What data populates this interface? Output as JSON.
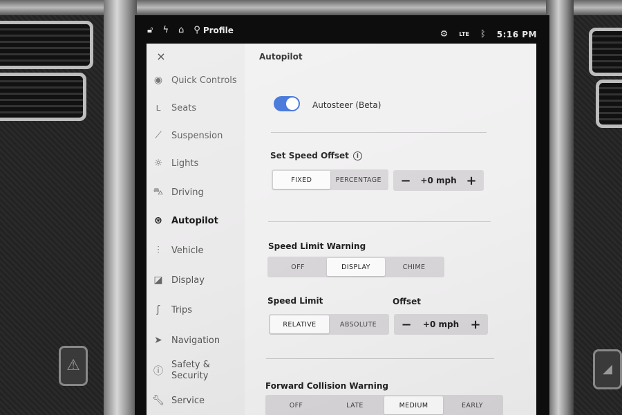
{
  "status_bar": {
    "lock_icon": "unlock-icon",
    "bolt_icon": "lightning-icon",
    "home_icon": "home-icon",
    "profile_icon": "person-icon",
    "profile_label": "Profile",
    "settings_icon": "gear-icon",
    "network": "LTE",
    "bluetooth_icon": "bluetooth-icon",
    "time": "5:16 PM"
  },
  "sidebar": {
    "close_glyph": "×",
    "items": [
      {
        "label": "Quick Controls",
        "icon": "toggle-icon"
      },
      {
        "label": "Seats",
        "icon": "seat-icon"
      },
      {
        "label": "Suspension",
        "icon": "suspension-icon"
      },
      {
        "label": "Lights",
        "icon": "light-bulb-icon"
      },
      {
        "label": "Driving",
        "icon": "car-icon"
      },
      {
        "label": "Autopilot",
        "icon": "steering-wheel-icon",
        "active": true
      },
      {
        "label": "Vehicle",
        "icon": "sliders-icon"
      },
      {
        "label": "Display",
        "icon": "display-icon"
      },
      {
        "label": "Trips",
        "icon": "trips-icon"
      },
      {
        "label": "Navigation",
        "icon": "navigation-arrow-icon"
      },
      {
        "label_line1": "Safety &",
        "label_line2": "Security",
        "icon": "alert-circle-icon"
      },
      {
        "label": "Service",
        "icon": "wrench-icon"
      }
    ]
  },
  "panel": {
    "title": "Autopilot",
    "autosteer": {
      "label": "Autosteer (Beta)",
      "enabled": true
    },
    "set_speed_offset": {
      "label": "Set Speed Offset",
      "options": [
        "FIXED",
        "PERCENTAGE"
      ],
      "selected": "FIXED",
      "minus": "−",
      "value": "+0 mph",
      "plus": "+"
    },
    "speed_limit_warning": {
      "label": "Speed Limit Warning",
      "options": [
        "OFF",
        "DISPLAY",
        "CHIME"
      ],
      "selected": "DISPLAY"
    },
    "speed_limit": {
      "label": "Speed Limit",
      "offset_label": "Offset",
      "options": [
        "RELATIVE",
        "ABSOLUTE"
      ],
      "selected": "RELATIVE",
      "minus": "−",
      "value": "+0 mph",
      "plus": "+"
    },
    "forward_collision_warning": {
      "label": "Forward Collision Warning",
      "options": [
        "OFF",
        "LATE",
        "MEDIUM",
        "EARLY"
      ],
      "selected": "MEDIUM"
    }
  },
  "colors": {
    "accent": "#3b6fd8",
    "screen_bg": "#f1f0f1",
    "sidebar_bg": "#ebeaeb"
  }
}
